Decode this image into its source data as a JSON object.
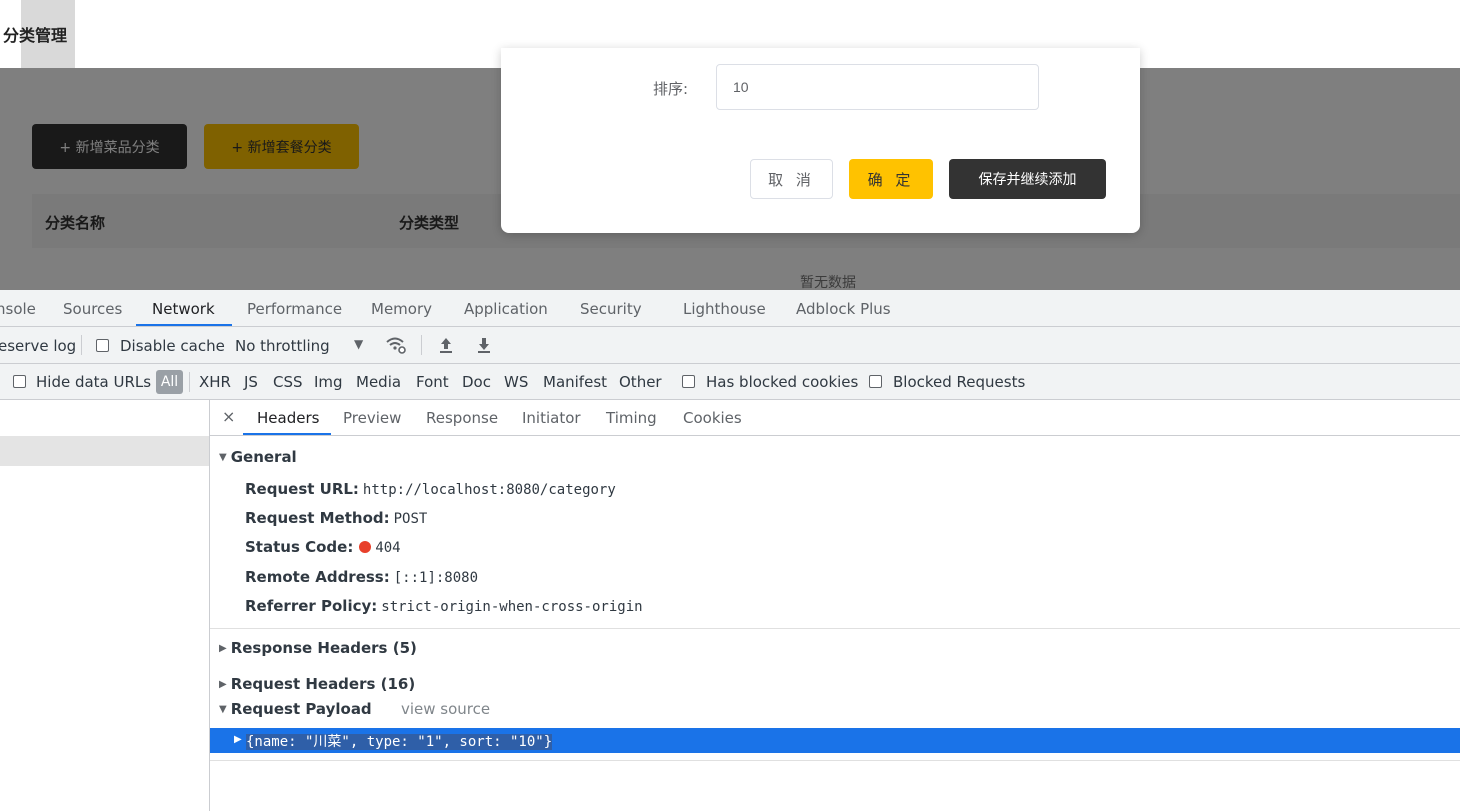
{
  "app": {
    "title": "分类管理",
    "buttons": {
      "add_dish_category": "+ 新增菜品分类",
      "add_meal_category": "+ 新增套餐分类"
    },
    "table": {
      "headers": [
        "分类名称",
        "分类类型"
      ],
      "empty_text": "暂无数据"
    }
  },
  "dialog": {
    "sort_label": "排序:",
    "sort_value": "10",
    "cancel_label": "取 消",
    "ok_label": "确 定",
    "save_continue_label": "保存并继续添加"
  },
  "devtools": {
    "tabs": [
      "nsole",
      "Sources",
      "Network",
      "Performance",
      "Memory",
      "Application",
      "Security",
      "Lighthouse",
      "Adblock Plus"
    ],
    "active_tab": "Network",
    "toolbar": {
      "preserve_log": "eserve log",
      "disable_cache": "Disable cache",
      "throttling": "No throttling",
      "dropdown_arrow": "▼"
    },
    "filter": {
      "hide_data_urls": "Hide data URLs",
      "all": "All",
      "types": [
        "XHR",
        "JS",
        "CSS",
        "Img",
        "Media",
        "Font",
        "Doc",
        "WS",
        "Manifest",
        "Other"
      ],
      "has_blocked_cookies": "Has blocked cookies",
      "blocked_requests": "Blocked Requests"
    },
    "detail_tabs": [
      "Headers",
      "Preview",
      "Response",
      "Initiator",
      "Timing",
      "Cookies"
    ],
    "close_glyph": "×",
    "general": {
      "title": "General",
      "request_url_label": "Request URL:",
      "request_url": "http://localhost:8080/category",
      "request_method_label": "Request Method:",
      "request_method": "POST",
      "status_code_label": "Status Code:",
      "status_code": "404",
      "remote_address_label": "Remote Address:",
      "remote_address": "[::1]:8080",
      "referrer_policy_label": "Referrer Policy:",
      "referrer_policy": "strict-origin-when-cross-origin"
    },
    "response_headers": "Response Headers (5)",
    "request_headers": "Request Headers (16)",
    "request_payload": "Request Payload",
    "view_source": "view source",
    "payload": "{name: \"川菜\", type: \"1\", sort: \"10\"}",
    "colors": {
      "accent": "#1a73e8",
      "status_error": "#e8402b",
      "brand_yellow": "#ffc200",
      "brand_dark": "#333333"
    }
  }
}
